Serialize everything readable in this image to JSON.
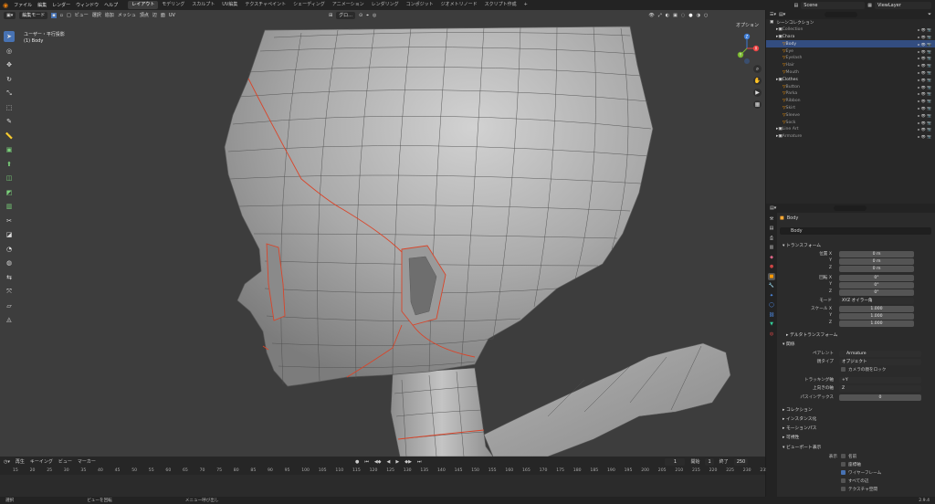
{
  "topbar": {
    "menus": [
      "ファイル",
      "編集",
      "レンダー",
      "ウィンドウ",
      "ヘルプ"
    ],
    "workspaces": [
      "レイアウト",
      "モデリング",
      "スカルプト",
      "UV編集",
      "テクスチャペイント",
      "シェーディング",
      "アニメーション",
      "レンダリング",
      "コンポジット",
      "ジオメトリノード",
      "スクリプト作成"
    ],
    "active_workspace": "レイアウト",
    "add_tab": "+",
    "scene": "Scene",
    "view_layer": "ViewLayer"
  },
  "viewport": {
    "mode": "編集モード",
    "menus": [
      "ビュー",
      "選択",
      "追加",
      "メッシュ",
      "頂点",
      "辺",
      "面",
      "UV"
    ],
    "transform_orientation": "グロ...",
    "options": "オプション",
    "info_line1": "ユーザー・平行投影",
    "info_line2": "(1) Body",
    "axis_x": "X",
    "axis_y": "Y",
    "axis_z": "Z",
    "accent": "#4772b3",
    "seam_color": "#d9452a"
  },
  "tools": [
    "cursor-tool",
    "cursor3d-tool",
    "move-tool",
    "rotate-tool",
    "scale-tool",
    "transform-tool",
    "annotate-tool",
    "measure-tool",
    "add-cube-tool",
    "extrude-tool",
    "inset-tool",
    "bevel-tool",
    "loopcut-tool",
    "knife-tool",
    "polybuild-tool",
    "spin-tool",
    "smooth-tool",
    "edge-slide-tool",
    "shrink-tool",
    "shear-tool",
    "rip-tool"
  ],
  "timeline": {
    "menus": [
      "再生",
      "キーイング",
      "ビュー",
      "マーカー"
    ],
    "current_frame": "1",
    "start_label": "開始",
    "start": "1",
    "end_label": "終了",
    "end": "250",
    "ruler": [
      "15",
      "20",
      "25",
      "30",
      "35",
      "40",
      "45",
      "50",
      "55",
      "60",
      "65",
      "70",
      "75",
      "80",
      "85",
      "90",
      "95",
      "100",
      "105",
      "110",
      "115",
      "120",
      "125",
      "130",
      "135",
      "140",
      "145",
      "150",
      "155",
      "160",
      "165",
      "170",
      "175",
      "180",
      "185",
      "190",
      "195",
      "200",
      "205",
      "210",
      "215",
      "220",
      "225",
      "230",
      "235"
    ]
  },
  "statusbar": {
    "left": "選択",
    "middle": "ビューを回転",
    "right": "メニュー呼び出し",
    "version": "2.9.4"
  },
  "outliner": {
    "title": "シーンコレクション",
    "rows": [
      {
        "label": "Collection",
        "indent": 1,
        "dim": true,
        "sel": false
      },
      {
        "label": "Chara",
        "indent": 1,
        "dim": false,
        "sel": false
      },
      {
        "label": "Body",
        "indent": 2,
        "dim": false,
        "sel": true
      },
      {
        "label": "Eye",
        "indent": 2,
        "dim": true,
        "sel": false
      },
      {
        "label": "Eyelash",
        "indent": 2,
        "dim": true,
        "sel": false
      },
      {
        "label": "Hair",
        "indent": 2,
        "dim": true,
        "sel": false
      },
      {
        "label": "Mouth",
        "indent": 2,
        "dim": true,
        "sel": false
      },
      {
        "label": "Clothes",
        "indent": 1,
        "dim": false,
        "sel": false
      },
      {
        "label": "Button",
        "indent": 2,
        "dim": true,
        "sel": false
      },
      {
        "label": "Parka",
        "indent": 2,
        "dim": true,
        "sel": false
      },
      {
        "label": "Ribbon",
        "indent": 2,
        "dim": true,
        "sel": false
      },
      {
        "label": "Skirt",
        "indent": 2,
        "dim": true,
        "sel": false
      },
      {
        "label": "Sleeve",
        "indent": 2,
        "dim": true,
        "sel": false
      },
      {
        "label": "Sock",
        "indent": 2,
        "dim": true,
        "sel": false
      },
      {
        "label": "Line Art",
        "indent": 1,
        "dim": true,
        "sel": false
      },
      {
        "label": "Armature",
        "indent": 1,
        "dim": true,
        "sel": false
      }
    ]
  },
  "properties": {
    "object_name": "Body",
    "object_field": "Body",
    "transform_title": "トランスフォーム",
    "location_label": "位置 X",
    "rotation_label": "回転 X",
    "scale_label": "スケール X",
    "y_label": "Y",
    "z_label": "Z",
    "loc": [
      "0 m",
      "0 m",
      "0 m"
    ],
    "rot": [
      "0°",
      "0°",
      "0°"
    ],
    "mode_label": "モード",
    "mode_value": "XYZ オイラー角",
    "scale": [
      "1.000",
      "1.000",
      "1.000"
    ],
    "delta_title": "デルタトランスフォーム",
    "relations_title": "関係",
    "parent_label": "ペアレント",
    "parent_value": "Armature",
    "parent_type_label": "親タイプ",
    "parent_type_value": "オブジェクト",
    "lock_camera": "カメラの親をロック",
    "tracking_label": "トラッキング軸",
    "tracking_value": "+Y",
    "up_label": "上向きの軸",
    "up_value": "Z",
    "pass_label": "パスインデックス",
    "pass_value": "0",
    "collection_title": "コレクション",
    "instancing_title": "インスタンス化",
    "motion_title": "モーションパス",
    "visibility_title": "可視性",
    "viewport_display_title": "ビューポート表示",
    "display_label": "表示",
    "display_opts": [
      {
        "label": "名前",
        "on": false
      },
      {
        "label": "座標軸",
        "on": false
      },
      {
        "label": "ワイヤーフレーム",
        "on": true
      },
      {
        "label": "すべての辺",
        "on": false
      },
      {
        "label": "テクスチャ空間",
        "on": false
      }
    ]
  }
}
